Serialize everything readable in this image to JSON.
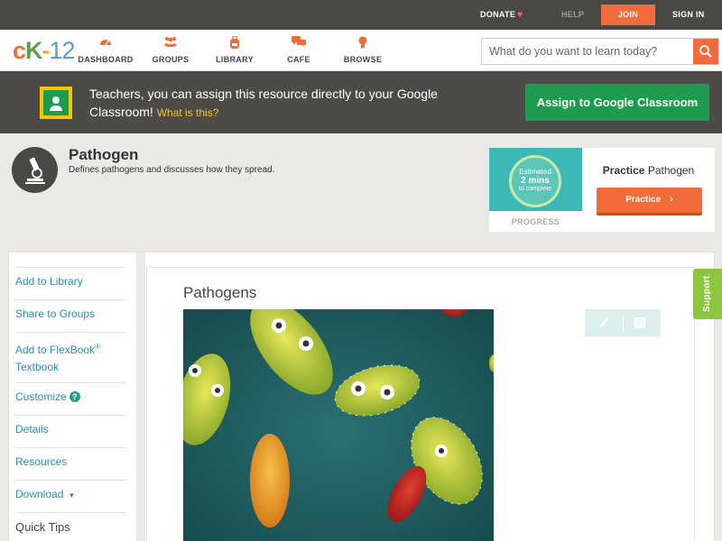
{
  "topbar": {
    "donate": "DONATE",
    "help": "HELP",
    "join": "JOIN",
    "signin": "SIGN IN"
  },
  "nav": {
    "logo": {
      "c": "c",
      "k": "K",
      "dash": "-",
      "num": "12"
    },
    "items": [
      {
        "label": "DASHBOARD",
        "icon": "dashboard-gauge-icon"
      },
      {
        "label": "GROUPS",
        "icon": "groups-people-icon"
      },
      {
        "label": "LIBRARY",
        "icon": "library-backpack-icon"
      },
      {
        "label": "CAFE",
        "icon": "cafe-chat-icon"
      },
      {
        "label": "BROWSE",
        "icon": "browse-lightbulb-icon"
      }
    ],
    "search_placeholder": "What do you want to learn today?"
  },
  "banner": {
    "text": "Teachers, you can assign this resource directly to your Google Classroom!",
    "what": "What is this?",
    "button": "Assign to Google Classroom"
  },
  "concept": {
    "title": "Pathogen",
    "description": "Defines pathogens and discusses how they spread."
  },
  "practice": {
    "estimate_l1": "Estimated",
    "estimate_l2": "2 mins",
    "estimate_l3": "to complete",
    "progress_label": "PROGRESS",
    "title_bold": "Practice",
    "title_rest": "Pathogen",
    "button": "Practice"
  },
  "sidebar": {
    "add_library": "Add to Library",
    "share_groups": "Share to Groups",
    "add_flexbook_line1": "Add to FlexBook",
    "reg": "®",
    "add_flexbook_line2": "Textbook",
    "customize": "Customize",
    "details": "Details",
    "resources": "Resources",
    "download": "Download",
    "quick_tips": "Quick Tips"
  },
  "content": {
    "title": "Pathogens"
  },
  "support": "Support",
  "colors": {
    "accent": "#f26b3a",
    "green": "#1f9b4f",
    "link": "#2b8fb0",
    "support": "#8cc63f"
  }
}
